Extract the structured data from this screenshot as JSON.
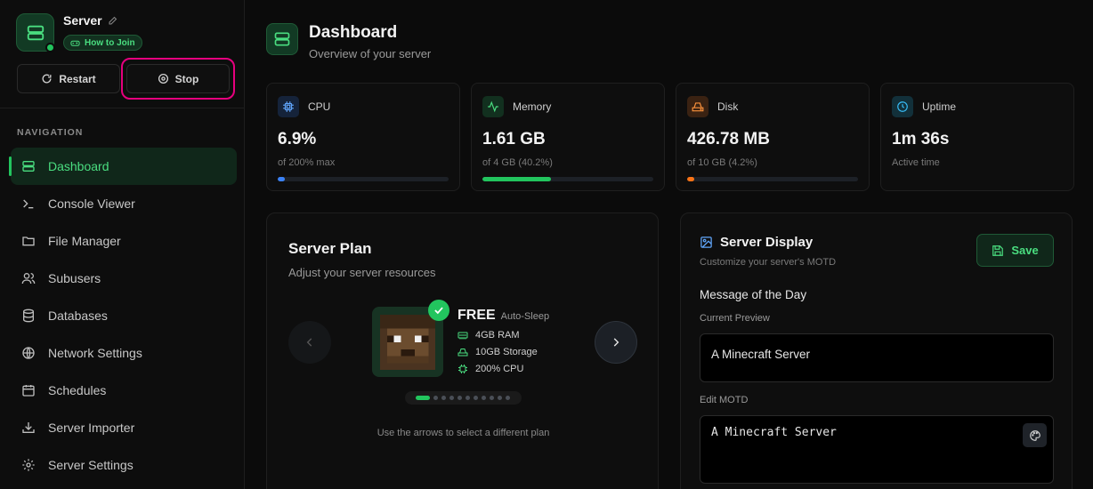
{
  "server": {
    "name": "Server",
    "join_label": "How to Join",
    "restart_label": "Restart",
    "stop_label": "Stop"
  },
  "nav": {
    "title": "NAVIGATION",
    "items": [
      {
        "label": "Dashboard",
        "icon": "server-icon",
        "active": true
      },
      {
        "label": "Console Viewer",
        "icon": "terminal-icon"
      },
      {
        "label": "File Manager",
        "icon": "folder-icon"
      },
      {
        "label": "Subusers",
        "icon": "users-icon"
      },
      {
        "label": "Databases",
        "icon": "database-icon"
      },
      {
        "label": "Network Settings",
        "icon": "globe-icon"
      },
      {
        "label": "Schedules",
        "icon": "calendar-icon"
      },
      {
        "label": "Server Importer",
        "icon": "import-icon"
      },
      {
        "label": "Server Settings",
        "icon": "gear-icon"
      }
    ]
  },
  "header": {
    "title": "Dashboard",
    "subtitle": "Overview of your server"
  },
  "stats": [
    {
      "label": "CPU",
      "value": "6.9%",
      "sub": "of 200% max",
      "percent": 3.45,
      "color": "#3b82f6",
      "icon": "cpu-icon"
    },
    {
      "label": "Memory",
      "value": "1.61 GB",
      "sub": "of 4 GB (40.2%)",
      "percent": 40.2,
      "color": "#22c55e",
      "icon": "activity-icon"
    },
    {
      "label": "Disk",
      "value": "426.78 MB",
      "sub": "of 10 GB (4.2%)",
      "percent": 4.2,
      "color": "#f97316",
      "icon": "hard-drive-icon"
    },
    {
      "label": "Uptime",
      "value": "1m 36s",
      "sub": "Active time",
      "icon": "clock-icon"
    }
  ],
  "plan": {
    "title": "Server Plan",
    "subtitle": "Adjust your server resources",
    "name": "FREE",
    "tag": "Auto-Sleep",
    "features": [
      "4GB RAM",
      "10GB Storage",
      "200% CPU"
    ],
    "hint": "Use the arrows to select a different plan",
    "page_count": 11,
    "current_page": 1
  },
  "display": {
    "title": "Server Display",
    "subtitle": "Customize your server's MOTD",
    "save_label": "Save",
    "motd_title": "Message of the Day",
    "preview_label": "Current Preview",
    "preview_text": "A Minecraft Server",
    "edit_label": "Edit MOTD",
    "edit_value": "A Minecraft Server"
  },
  "colors": {
    "accent": "#22c55e",
    "highlight_ring": "#e6007e"
  }
}
